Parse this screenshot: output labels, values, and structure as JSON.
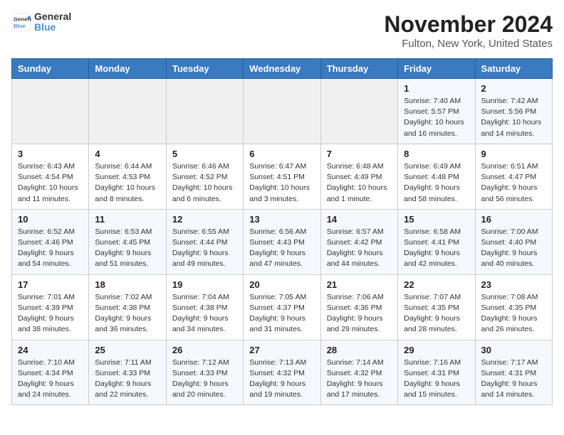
{
  "header": {
    "logo_line1": "General",
    "logo_line2": "Blue",
    "month": "November 2024",
    "location": "Fulton, New York, United States"
  },
  "days_of_week": [
    "Sunday",
    "Monday",
    "Tuesday",
    "Wednesday",
    "Thursday",
    "Friday",
    "Saturday"
  ],
  "weeks": [
    [
      {
        "day": "",
        "info": ""
      },
      {
        "day": "",
        "info": ""
      },
      {
        "day": "",
        "info": ""
      },
      {
        "day": "",
        "info": ""
      },
      {
        "day": "",
        "info": ""
      },
      {
        "day": "1",
        "info": "Sunrise: 7:40 AM\nSunset: 5:57 PM\nDaylight: 10 hours and 16 minutes."
      },
      {
        "day": "2",
        "info": "Sunrise: 7:42 AM\nSunset: 5:56 PM\nDaylight: 10 hours and 14 minutes."
      }
    ],
    [
      {
        "day": "3",
        "info": "Sunrise: 6:43 AM\nSunset: 4:54 PM\nDaylight: 10 hours and 11 minutes."
      },
      {
        "day": "4",
        "info": "Sunrise: 6:44 AM\nSunset: 4:53 PM\nDaylight: 10 hours and 8 minutes."
      },
      {
        "day": "5",
        "info": "Sunrise: 6:46 AM\nSunset: 4:52 PM\nDaylight: 10 hours and 6 minutes."
      },
      {
        "day": "6",
        "info": "Sunrise: 6:47 AM\nSunset: 4:51 PM\nDaylight: 10 hours and 3 minutes."
      },
      {
        "day": "7",
        "info": "Sunrise: 6:48 AM\nSunset: 4:49 PM\nDaylight: 10 hours and 1 minute."
      },
      {
        "day": "8",
        "info": "Sunrise: 6:49 AM\nSunset: 4:48 PM\nDaylight: 9 hours and 58 minutes."
      },
      {
        "day": "9",
        "info": "Sunrise: 6:51 AM\nSunset: 4:47 PM\nDaylight: 9 hours and 56 minutes."
      }
    ],
    [
      {
        "day": "10",
        "info": "Sunrise: 6:52 AM\nSunset: 4:46 PM\nDaylight: 9 hours and 54 minutes."
      },
      {
        "day": "11",
        "info": "Sunrise: 6:53 AM\nSunset: 4:45 PM\nDaylight: 9 hours and 51 minutes."
      },
      {
        "day": "12",
        "info": "Sunrise: 6:55 AM\nSunset: 4:44 PM\nDaylight: 9 hours and 49 minutes."
      },
      {
        "day": "13",
        "info": "Sunrise: 6:56 AM\nSunset: 4:43 PM\nDaylight: 9 hours and 47 minutes."
      },
      {
        "day": "14",
        "info": "Sunrise: 6:57 AM\nSunset: 4:42 PM\nDaylight: 9 hours and 44 minutes."
      },
      {
        "day": "15",
        "info": "Sunrise: 6:58 AM\nSunset: 4:41 PM\nDaylight: 9 hours and 42 minutes."
      },
      {
        "day": "16",
        "info": "Sunrise: 7:00 AM\nSunset: 4:40 PM\nDaylight: 9 hours and 40 minutes."
      }
    ],
    [
      {
        "day": "17",
        "info": "Sunrise: 7:01 AM\nSunset: 4:39 PM\nDaylight: 9 hours and 38 minutes."
      },
      {
        "day": "18",
        "info": "Sunrise: 7:02 AM\nSunset: 4:38 PM\nDaylight: 9 hours and 36 minutes."
      },
      {
        "day": "19",
        "info": "Sunrise: 7:04 AM\nSunset: 4:38 PM\nDaylight: 9 hours and 34 minutes."
      },
      {
        "day": "20",
        "info": "Sunrise: 7:05 AM\nSunset: 4:37 PM\nDaylight: 9 hours and 31 minutes."
      },
      {
        "day": "21",
        "info": "Sunrise: 7:06 AM\nSunset: 4:36 PM\nDaylight: 9 hours and 29 minutes."
      },
      {
        "day": "22",
        "info": "Sunrise: 7:07 AM\nSunset: 4:35 PM\nDaylight: 9 hours and 28 minutes."
      },
      {
        "day": "23",
        "info": "Sunrise: 7:08 AM\nSunset: 4:35 PM\nDaylight: 9 hours and 26 minutes."
      }
    ],
    [
      {
        "day": "24",
        "info": "Sunrise: 7:10 AM\nSunset: 4:34 PM\nDaylight: 9 hours and 24 minutes."
      },
      {
        "day": "25",
        "info": "Sunrise: 7:11 AM\nSunset: 4:33 PM\nDaylight: 9 hours and 22 minutes."
      },
      {
        "day": "26",
        "info": "Sunrise: 7:12 AM\nSunset: 4:33 PM\nDaylight: 9 hours and 20 minutes."
      },
      {
        "day": "27",
        "info": "Sunrise: 7:13 AM\nSunset: 4:32 PM\nDaylight: 9 hours and 19 minutes."
      },
      {
        "day": "28",
        "info": "Sunrise: 7:14 AM\nSunset: 4:32 PM\nDaylight: 9 hours and 17 minutes."
      },
      {
        "day": "29",
        "info": "Sunrise: 7:16 AM\nSunset: 4:31 PM\nDaylight: 9 hours and 15 minutes."
      },
      {
        "day": "30",
        "info": "Sunrise: 7:17 AM\nSunset: 4:31 PM\nDaylight: 9 hours and 14 minutes."
      }
    ]
  ]
}
